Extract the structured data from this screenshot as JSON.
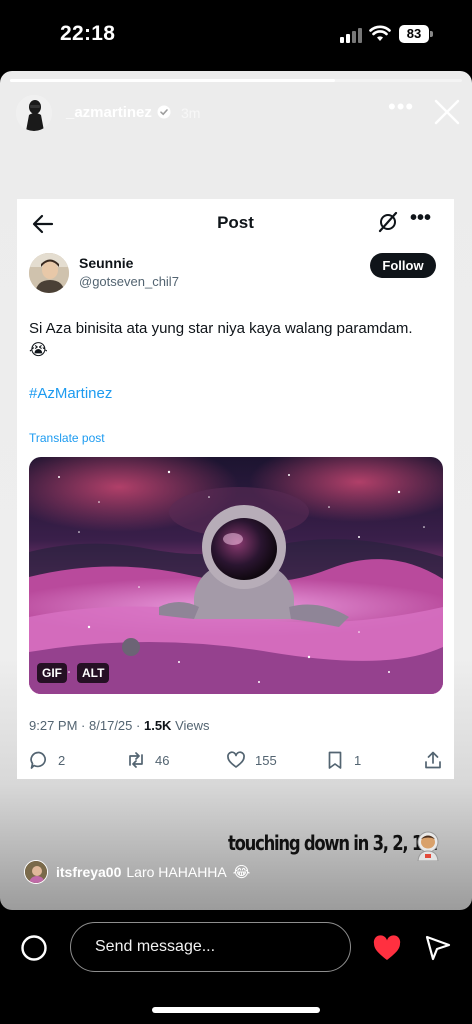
{
  "status_bar": {
    "time": "22:18",
    "battery": "83",
    "signal_bars_on": 2,
    "icons": [
      "signal-icon",
      "wifi-icon",
      "battery-icon"
    ]
  },
  "story": {
    "progress": 0.72,
    "username": "_azmartinez",
    "verified": true,
    "time_ago": "3m",
    "more_label": "•••",
    "sticker_text": "touching down in 3, 2, 1...",
    "sticker_emoji": "astronaut",
    "mention": {
      "username": "itsfreya00",
      "text": "Laro HAHAHHA",
      "emoji": "😂"
    }
  },
  "tweet": {
    "header_title": "Post",
    "more_label": "•••",
    "author_name": "Seunnie",
    "author_handle": "@gotseven_chil7",
    "follow_label": "Follow",
    "text": "Si Aza binisita ata yung star niya kaya walang paramdam.",
    "text_emoji": "😭",
    "hashtag": "#AzMartinez",
    "translate_label": "Translate post",
    "media_badges": [
      "GIF",
      "ALT"
    ],
    "meta": {
      "time": "9:27 PM",
      "separator": "·",
      "date": "8/17/25",
      "views_count": "1.5K",
      "views_label": "Views"
    },
    "actions": {
      "replies": "2",
      "reposts": "46",
      "likes": "155",
      "bookmarks": "1"
    }
  },
  "bottom_bar": {
    "message_placeholder": "Send message...",
    "heart_color": "#ff3040"
  },
  "colors": {
    "link_blue": "#1d9bf0",
    "text_dark": "#0f1419",
    "text_gray": "#536471"
  }
}
